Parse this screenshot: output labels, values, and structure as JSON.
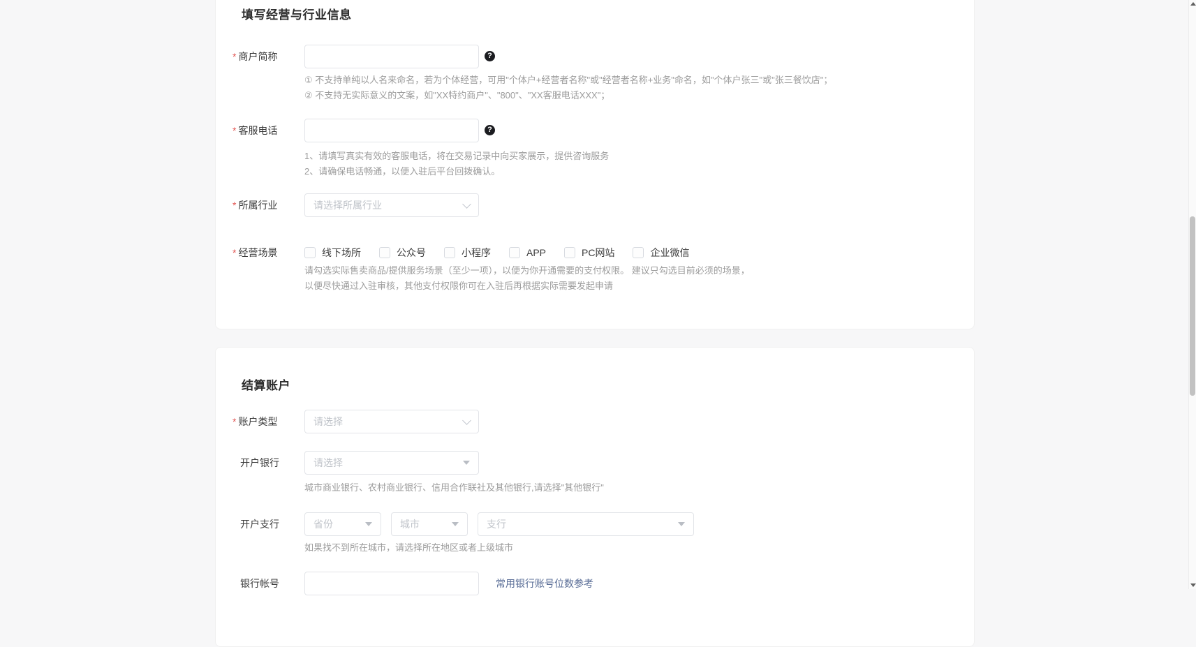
{
  "colors": {
    "page_background": "#f7f7f8",
    "card_background": "#ffffff",
    "required_asterisk": "#e25552",
    "hint_text": "#9c9c9c",
    "link_blue": "#576b95"
  },
  "business_section": {
    "title": "填写经营与行业信息",
    "merchant_short_name": {
      "required_mark": "*",
      "label": "商户简称",
      "value": "",
      "help_icon_glyph": "?",
      "hint_line1": "① 不支持单纯以人名来命名，若为个体经营，可用\"个体户+经营者名称\"或\"经营者名称+业务\"命名，如\"个体户张三\"或\"张三餐饮店\"；",
      "hint_line2": "② 不支持无实际意义的文案，如\"XX特约商户\"、\"800\"、\"XX客服电话XXX\"；"
    },
    "service_phone": {
      "required_mark": "*",
      "label": "客服电话",
      "value": "",
      "help_icon_glyph": "?",
      "hint_line1": "1、请填写真实有效的客服电话，将在交易记录中向买家展示，提供咨询服务",
      "hint_line2": "2、请确保电话畅通，以便入驻后平台回拨确认。"
    },
    "industry": {
      "required_mark": "*",
      "label": "所属行业",
      "placeholder": "请选择所属行业"
    },
    "business_scenes": {
      "required_mark": "*",
      "label": "经营场景",
      "options": [
        "线下场所",
        "公众号",
        "小程序",
        "APP",
        "PC网站",
        "企业微信"
      ],
      "hint_line1": "请勾选实际售卖商品/提供服务场景（至少一项），以便为你开通需要的支付权限。 建议只勾选目前必须的场景，",
      "hint_line2": "以便尽快通过入驻审核，其他支付权限你可在入驻后再根据实际需要发起申请"
    }
  },
  "settlement_section": {
    "title": "结算账户",
    "account_type": {
      "required_mark": "*",
      "label": "账户类型",
      "placeholder": "请选择"
    },
    "bank": {
      "label": "开户银行",
      "placeholder": "请选择",
      "hint": "城市商业银行、农村商业银行、信用合作联社及其他银行,请选择\"其他银行\""
    },
    "branch": {
      "label": "开户支行",
      "province_placeholder": "省份",
      "city_placeholder": "城市",
      "branch_placeholder": "支行",
      "hint": "如果找不到所在城市，请选择所在地区或者上级城市"
    },
    "bank_account": {
      "label": "银行帐号",
      "value": "",
      "link_text": "常用银行账号位数参考"
    }
  }
}
